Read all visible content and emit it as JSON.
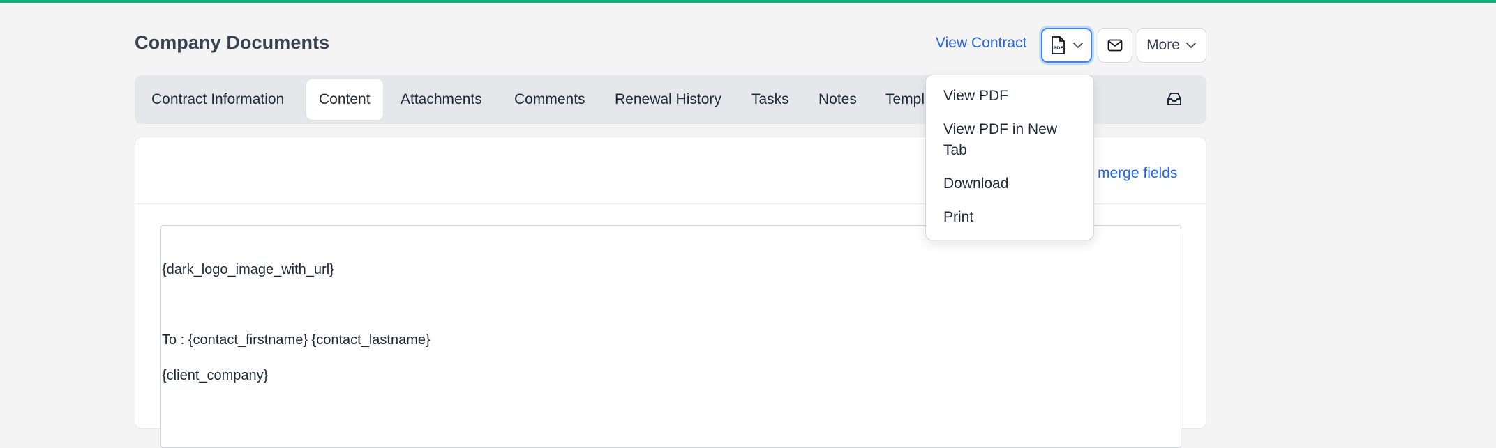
{
  "header": {
    "title": "Company Documents",
    "view_contract_label": "View Contract",
    "pdf_icon_text": "PDF",
    "more_label": "More"
  },
  "tabs": [
    {
      "label": "Contract Information"
    },
    {
      "label": "Content",
      "active": true
    },
    {
      "label": "Attachments"
    },
    {
      "label": "Comments"
    },
    {
      "label": "Renewal History"
    },
    {
      "label": "Tasks"
    },
    {
      "label": "Notes"
    },
    {
      "label": "Templ"
    }
  ],
  "card": {
    "merge_fields_label": "merge fields"
  },
  "editor": {
    "lines": [
      "{dark_logo_image_with_url}",
      "To : {contact_firstname} {contact_lastname}",
      "{client_company}"
    ]
  },
  "pdf_menu": {
    "items": [
      {
        "label": "View PDF"
      },
      {
        "label": "View PDF in New Tab"
      },
      {
        "label": "Download"
      },
      {
        "label": "Print"
      }
    ]
  },
  "colors": {
    "accent_bar": "#10b27a",
    "link": "#2563eb",
    "focus_ring": "#3b82f6"
  },
  "icons": {
    "pdf_button": "pdf-file-icon",
    "mail_button": "mail-icon",
    "tab_bar_right": "inbox-icon",
    "chevron": "chevron-down-icon"
  }
}
